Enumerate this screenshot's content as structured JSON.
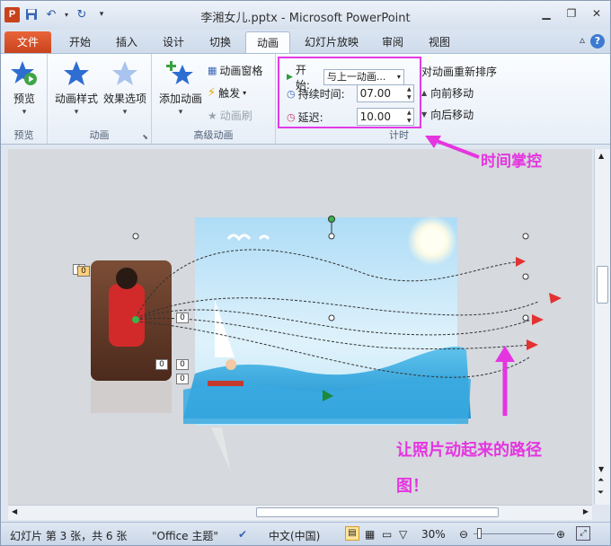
{
  "window": {
    "title": "李湘女儿.pptx - Microsoft PowerPoint",
    "app_icon": "P"
  },
  "tabs": [
    "文件",
    "开始",
    "插入",
    "设计",
    "切换",
    "动画",
    "幻灯片放映",
    "审阅",
    "视图"
  ],
  "active_tab": "动画",
  "ribbon": {
    "preview": {
      "label": "预览",
      "group": "预览"
    },
    "animation": {
      "style_label": "动画样式",
      "effect_label": "效果选项",
      "group": "动画"
    },
    "advanced": {
      "add_label": "添加动画",
      "pane_label": "动画窗格",
      "trigger_label": "触发",
      "painter_label": "动画刷",
      "group": "高级动画"
    },
    "timing": {
      "start_label": "开始:",
      "start_value": "与上一动画...",
      "duration_label": "持续时间:",
      "duration_value": "07.00",
      "delay_label": "延迟:",
      "delay_value": "10.00",
      "group": "计时"
    },
    "reorder": {
      "title": "对动画重新排序",
      "forward": "向前移动",
      "backward": "向后移动"
    }
  },
  "annotations": {
    "timing": "时间掌控",
    "path_line1": "让照片动起来的路径",
    "path_line2": "图！"
  },
  "slide": {
    "tags": [
      "0",
      "0",
      "0",
      "0",
      "0",
      "0"
    ]
  },
  "statusbar": {
    "slide_info": "幻灯片 第 3 张，共 6 张",
    "theme": "\"Office 主题\"",
    "language": "中文(中国)",
    "zoom": "30%"
  },
  "colors": {
    "annotation": "#e535e0",
    "file_tab": "#d4522a",
    "accent": "#2b5aa8"
  }
}
